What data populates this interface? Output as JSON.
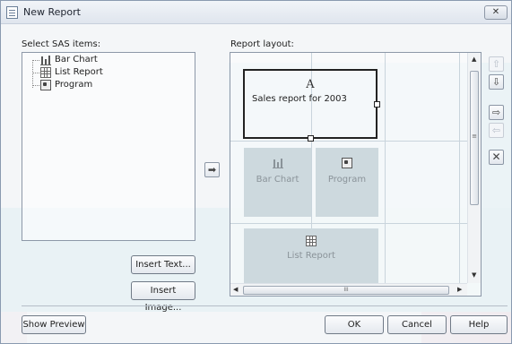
{
  "window": {
    "title": "New Report",
    "close_symbol": "✕"
  },
  "sas_items": {
    "label": "Select SAS items:",
    "items": [
      {
        "label": "Bar Chart",
        "icon": "bar-chart-icon"
      },
      {
        "label": "List Report",
        "icon": "list-report-icon"
      },
      {
        "label": "Program",
        "icon": "program-icon"
      }
    ]
  },
  "buttons": {
    "insert_text": "Insert Text...",
    "insert_image": "Insert Image...",
    "show_preview": "Show Preview",
    "ok": "OK",
    "cancel": "Cancel",
    "help": "Help"
  },
  "layout": {
    "label": "Report layout:",
    "text_box": {
      "heading": "A",
      "caption": "Sales report for 2003"
    },
    "tiles": [
      {
        "label": "Bar Chart",
        "icon": "bar-chart-icon"
      },
      {
        "label": "Program",
        "icon": "program-icon"
      },
      {
        "label": "List Report",
        "icon": "list-report-icon"
      }
    ],
    "hscroll_grip": "III",
    "vscroll_grip": "≡"
  },
  "side_controls": {
    "add_arrow": "➡",
    "move_up": "⇧",
    "move_down": "⇩",
    "move_right": "⇨",
    "move_left": "⇦",
    "remove": "✕"
  },
  "colors": {
    "watermark_teal": "#cdeaf1",
    "tile_fill": "#cdd9de",
    "border": "#8d98a8"
  }
}
